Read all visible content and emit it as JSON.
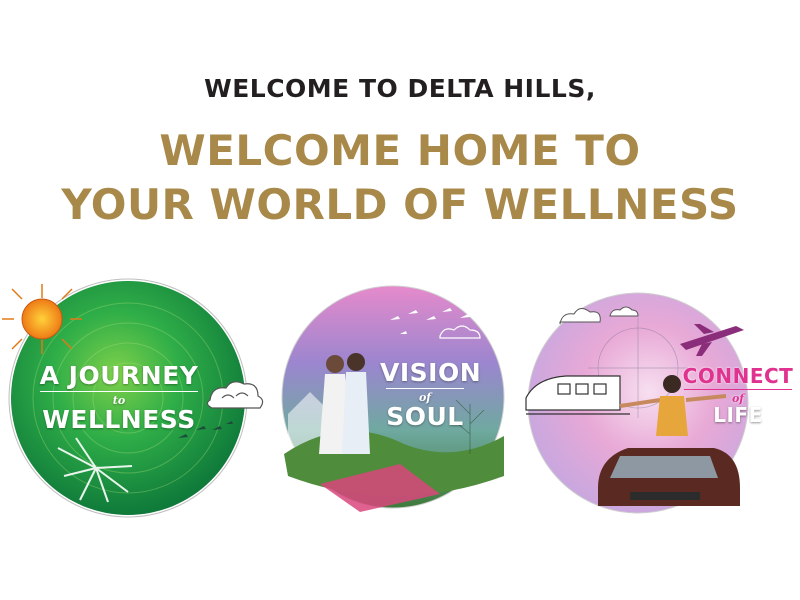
{
  "intro": {
    "kicker": "WELCOME TO DELTA HILLS,",
    "headline_line1": "WELCOME HOME TO",
    "headline_line2": "YOUR WORLD OF WELLNESS"
  },
  "cards": [
    {
      "line1": "A JOURNEY",
      "connector": "to",
      "line2": "WELLNESS",
      "palette": "green"
    },
    {
      "line1": "VISION",
      "connector": "of",
      "line2": "SOUL",
      "palette": "purple-pink"
    },
    {
      "line1": "CONNECT",
      "connector": "of",
      "line2": "LIFE",
      "palette": "pink-magenta"
    }
  ],
  "colors": {
    "kicker": "#231f20",
    "headline_gold": "#a8894a",
    "card1_green": "#2aa14a",
    "card2_purple": "#8a6fb8",
    "card3_magenta": "#e0338f"
  },
  "icons": [
    "sun-icon",
    "cloud-icon",
    "palm-leaf-icon",
    "birds-icon",
    "airplane-icon",
    "train-icon",
    "car-icon"
  ]
}
